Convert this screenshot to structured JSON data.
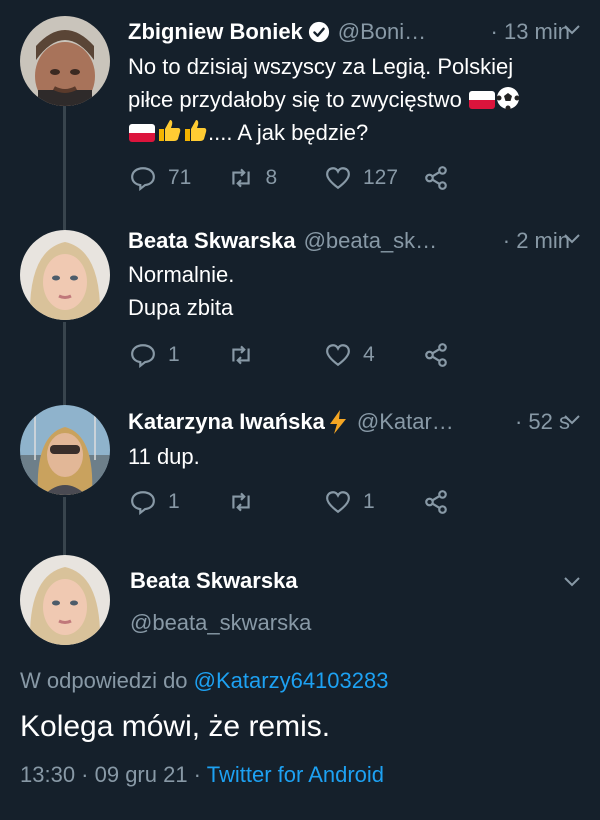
{
  "tweets": [
    {
      "name": "Zbigniew Boniek",
      "handle": "@Boni…",
      "time": "· 13 min",
      "lines": [
        "No to dzisiaj wszyscy za Legią. Polskiej",
        "piłce przydałoby się to zwycięstwo",
        ".... A jak będzie?"
      ],
      "replies": "71",
      "retweets": "8",
      "likes": "127"
    },
    {
      "name": "Beata Skwarska",
      "handle": "@beata_sk…",
      "time": "· 2 min",
      "lines": [
        "Normalnie.",
        "Dupa zbita"
      ],
      "replies": "1",
      "retweets": "",
      "likes": "4"
    },
    {
      "name": "Katarzyna Iwańska",
      "handle": "@Katar…",
      "time": "· 52 s",
      "lines": [
        "11 dup."
      ],
      "replies": "1",
      "retweets": "",
      "likes": "1"
    }
  ],
  "detail": {
    "name": "Beata Skwarska",
    "handle": "@beata_skwarska",
    "reply_prefix": "W odpowiedzi do",
    "reply_to": "@Katarzy64103283",
    "text": "Kolega mówi, że remis.",
    "datetime": "13:30 · 09 gru 21 ·",
    "client": "Twitter for Android"
  },
  "colors": {
    "background": "#15202b",
    "muted": "#8899a6",
    "link": "#1da1f2",
    "thread_line": "#38444d"
  },
  "icons": {
    "reply": "reply-icon",
    "retweet": "retweet-icon",
    "like": "like-icon",
    "share": "share-icon",
    "caret": "chevron-down-icon",
    "verified": "verified-badge-icon"
  }
}
